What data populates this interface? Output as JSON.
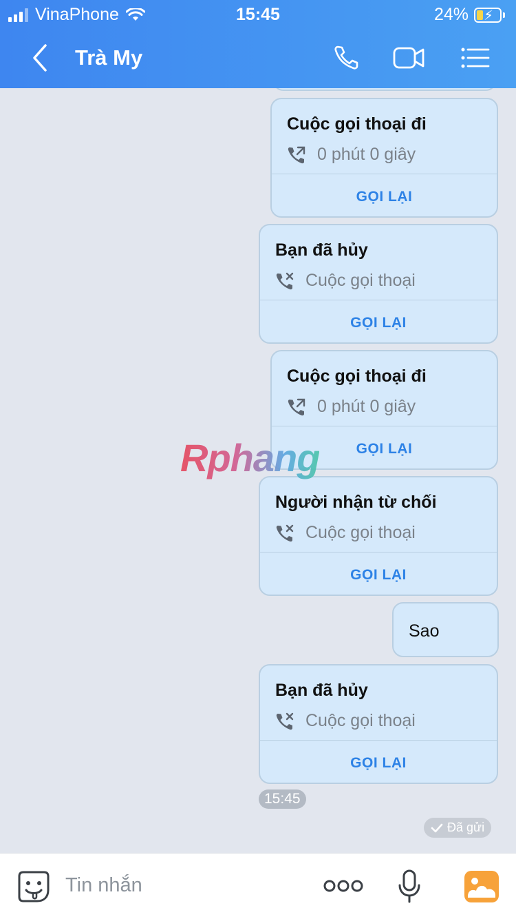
{
  "status_bar": {
    "carrier": "VinaPhone",
    "time": "15:45",
    "battery": "24%"
  },
  "header": {
    "title": "Trà My"
  },
  "messages": [
    {
      "head": "Cuộc gọi thoại đi",
      "sub": "0 phút 0 giây",
      "action": "GỌI LẠI"
    },
    {
      "head": "Bạn đã hủy",
      "sub": "Cuộc gọi thoại",
      "action": "GỌI LẠI"
    },
    {
      "head": "Cuộc gọi thoại đi",
      "sub": "0 phút 0 giây",
      "action": "GỌI LẠI"
    },
    {
      "head": "Người nhận từ chối",
      "sub": "Cuộc gọi thoại",
      "action": "GỌI LẠI"
    },
    {
      "text": "Sao"
    },
    {
      "head": "Bạn đã hủy",
      "sub": "Cuộc gọi thoại",
      "action": "GỌI LẠI"
    }
  ],
  "timestamp": "15:45",
  "sent_status": "Đã gửi",
  "watermark": "Rphang",
  "input": {
    "placeholder": "Tin nhắn"
  }
}
